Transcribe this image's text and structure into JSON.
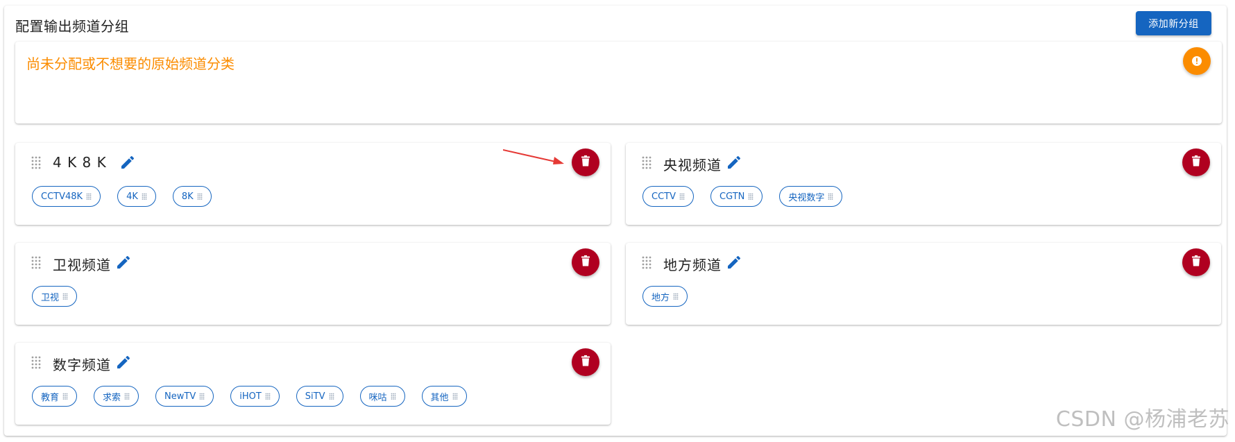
{
  "page": {
    "title": "配置输出频道分组",
    "add_button": "添加新分组"
  },
  "uncategorized": {
    "title": "尚未分配或不想要的原始频道分类",
    "icon": "alert-icon",
    "color": "#fb8c00"
  },
  "groups": [
    {
      "name": "4 K 8 K",
      "chips": [
        "CCTV48K",
        "4K",
        "8K"
      ]
    },
    {
      "name": "央视频道",
      "chips": [
        "CCTV",
        "CGTN",
        "央视数字"
      ]
    },
    {
      "name": "卫视频道",
      "chips": [
        "卫视"
      ]
    },
    {
      "name": "地方频道",
      "chips": [
        "地方"
      ]
    },
    {
      "name": "数字频道",
      "chips": [
        "教育",
        "求索",
        "NewTV",
        "iHOT",
        "SiTV",
        "咪咕",
        "其他"
      ]
    }
  ],
  "colors": {
    "primary": "#1565c0",
    "delete": "#b00020",
    "warning": "#fb8c00",
    "annotation_arrow": "#e53935"
  },
  "watermark": "CSDN @杨浦老苏"
}
